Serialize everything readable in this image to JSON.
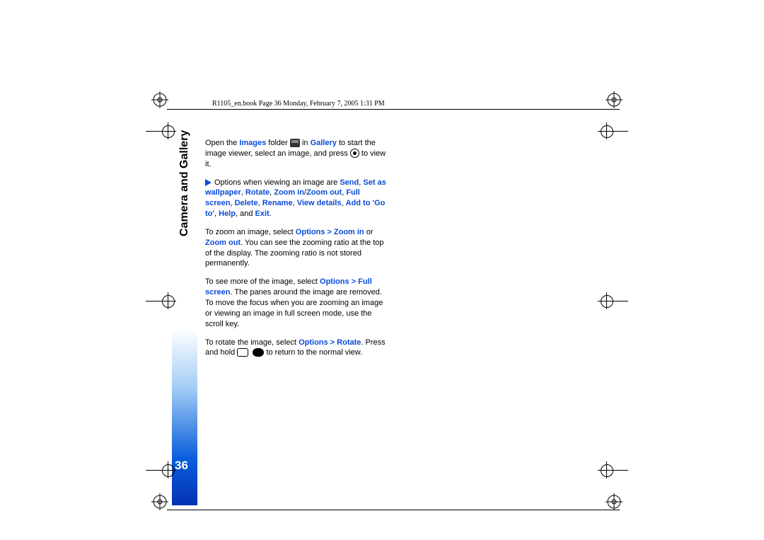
{
  "header": "R1105_en.book  Page 36  Monday, February 7, 2005  1:31 PM",
  "page_number": "36",
  "section_title": "Camera and Gallery",
  "p1": {
    "t1": "Open the ",
    "images": "Images",
    "t2": " folder ",
    "t3": " in ",
    "gallery": "Gallery",
    "t4": " to start the image viewer, select an image, and press ",
    "t5": " to view it."
  },
  "p2": {
    "lead": "Options when viewing an image are ",
    "send": "Send",
    "comma1": ", ",
    "setas": "Set as wallpaper",
    "comma2": ", ",
    "rotate": "Rotate",
    "comma3": ", ",
    "zoomin": "Zoom in",
    "slash": "/",
    "zoomout": "Zoom out",
    "comma4": ", ",
    "fullscreen": "Full screen",
    "comma5": ", ",
    "delete": "Delete",
    "comma6": ", ",
    "rename": "Rename",
    "comma7": ", ",
    "viewdetails": "View details",
    "comma8": ", ",
    "addgoto": "Add to 'Go to'",
    "comma9": ", ",
    "help": "Help",
    "and": ", and ",
    "exit": "Exit",
    "period": "."
  },
  "p3": {
    "t1": "To zoom an image, select ",
    "opt1": "Options > Zoom in",
    "or": " or ",
    "opt2": "Zoom out",
    "t2": ". You can see the zooming ratio at the top of the display. The zooming ratio is not stored permanently."
  },
  "p4": {
    "t1": "To see more of the image, select ",
    "opt": "Options > Full screen",
    "t2": ". The panes around the image are removed. To move the focus when you are zooming an image or viewing an image in full screen mode, use the scroll key."
  },
  "p5": {
    "t1": "To rotate the image, select ",
    "opt": "Options > Rotate",
    "t2": ". Press and hold ",
    "t3": " to return to the normal view."
  }
}
